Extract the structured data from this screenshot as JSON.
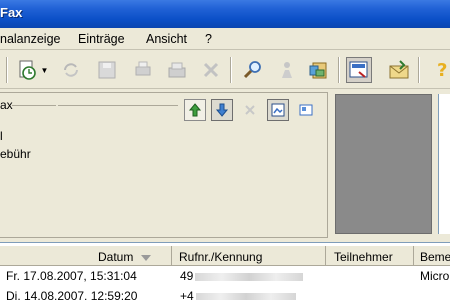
{
  "window": {
    "title": "Fax"
  },
  "menu": {
    "items": [
      "nalanzeige",
      "Einträge",
      "Ansicht",
      "?"
    ],
    "mnemonics": [
      "",
      "E",
      "A",
      "?"
    ]
  },
  "toolbar": {
    "buttons": [
      "new-entry",
      "refresh",
      "send",
      "save",
      "print",
      "forward",
      "delete",
      "search",
      "call",
      "phonebook",
      "fax-view",
      "reply",
      "help"
    ]
  },
  "upper_panel": {
    "group_label": "ax",
    "line1": "l",
    "line2": "ebühr"
  },
  "grid": {
    "columns": [
      "Datum",
      "Rufnr./Kennung",
      "Teilnehmer",
      "Beme"
    ],
    "rows": [
      {
        "datum": "Fr. 17.08.2007, 15:31:04",
        "rufnr": "49",
        "teilnehmer": "",
        "bemerkung": "Micro"
      },
      {
        "datum": "Di. 14.08.2007, 12:59:20",
        "rufnr": "+4",
        "teilnehmer": "",
        "bemerkung": ""
      }
    ]
  },
  "colors": {
    "titlebar": "#0b4fc7",
    "face": "#ece9d8",
    "preview": "#8a8a8a"
  }
}
